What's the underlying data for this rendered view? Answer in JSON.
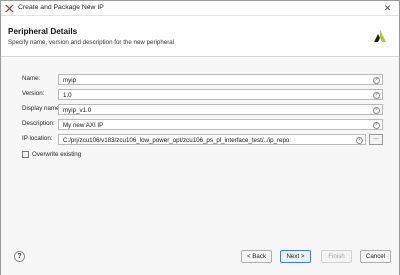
{
  "window": {
    "title": "Create and Package New IP",
    "close_glyph": "✕"
  },
  "header": {
    "title": "Peripheral Details",
    "subtitle": "Specify name, version and description for the new peripheral",
    "logo_icon": "xilinx-logo-icon"
  },
  "form": {
    "fields": [
      {
        "label": "Name:",
        "value": "myip"
      },
      {
        "label": "Version:",
        "value": "1.0"
      },
      {
        "label": "Display name:",
        "value": "myip_v1.0"
      },
      {
        "label": "Description:",
        "value": "My new AXI IP"
      },
      {
        "label": "IP location:",
        "value": "C:/prj/zcu106/v183/zcu106_low_power_opt/zcu106_ps_pl_interface_test/../ip_repo"
      }
    ],
    "clear_glyph": "×",
    "browse_label": "···",
    "overwrite_label": "Overwrite existing",
    "overwrite_checked": false
  },
  "footer": {
    "help_label": "?",
    "back_label": "< Back",
    "next_label": "Next >",
    "finish_label": "Finish",
    "cancel_label": "Cancel"
  },
  "colors": {
    "primary_button_border": "#3c7fd4",
    "xilinx_logo": "#a8c64a"
  }
}
